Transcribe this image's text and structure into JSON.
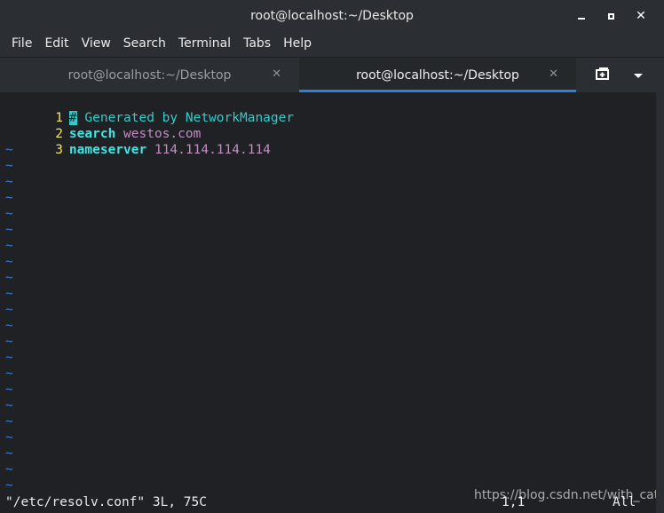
{
  "window": {
    "title": "root@localhost:~/Desktop"
  },
  "menubar": {
    "items": [
      "File",
      "Edit",
      "View",
      "Search",
      "Terminal",
      "Tabs",
      "Help"
    ]
  },
  "tabs": [
    {
      "label": "root@localhost:~/Desktop",
      "active": false
    },
    {
      "label": "root@localhost:~/Desktop",
      "active": true
    }
  ],
  "editor": {
    "lines": [
      {
        "number": "1",
        "cursor_char": "#",
        "text": " Generated by NetworkManager"
      },
      {
        "number": "2",
        "keyword": "search",
        "value": "westos.com"
      },
      {
        "number": "3",
        "keyword": "nameserver",
        "value": "114.114.114.114"
      }
    ],
    "empty_marker": "~",
    "status": {
      "file_info": "\"/etc/resolv.conf\" 3L, 75C",
      "position": "1,1",
      "scroll": "All"
    }
  },
  "watermark": "https://blog.csdn.net/with_cat",
  "colors": {
    "background": "#1f2124",
    "chrome": "#2b2e33",
    "line_number": "#f4e664",
    "comment": "#33cccc",
    "keyword": "#45e3e3",
    "value": "#c28dc6",
    "tilde": "#3a7dd8",
    "active_tab_underline": "#2b82d9"
  }
}
